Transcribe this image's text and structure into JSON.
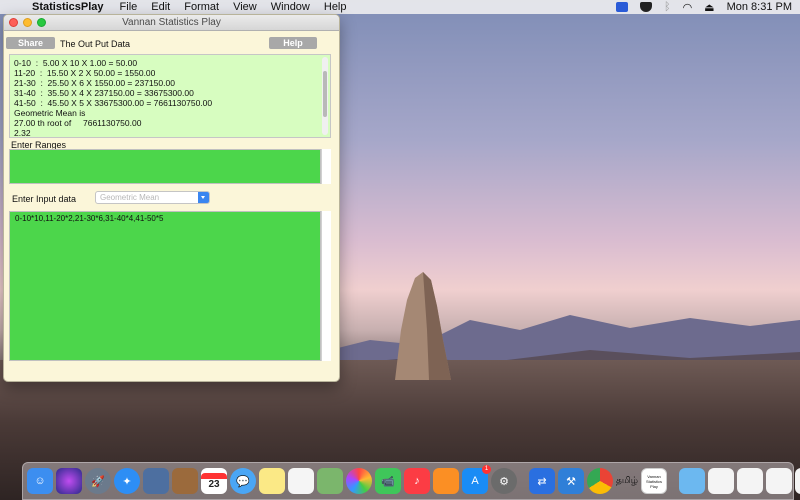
{
  "menubar": {
    "app_name": "StatisticsPlay",
    "items": [
      "File",
      "Edit",
      "Format",
      "View",
      "Window",
      "Help"
    ],
    "clock": "Mon 8:31 PM"
  },
  "window": {
    "title": "Vannan Statistics Play",
    "share_label": "Share",
    "help_label": "Help",
    "output_heading": "The Out Put Data",
    "output_lines": [
      "0-10  :  5.00 X 10 X 1.00 = 50.00",
      "11-20  :  15.50 X 2 X 50.00 = 1550.00",
      "21-30  :  25.50 X 6 X 1550.00 = 237150.00",
      "31-40  :  35.50 X 4 X 237150.00 = 33675300.00",
      "41-50  :  45.50 X 5 X 33675300.00 = 7661130750.00",
      "Geometric Mean is",
      "27.00 th root of     7661130750.00",
      "2.32"
    ],
    "ranges_label": "Enter Ranges",
    "input_label": "Enter Input data",
    "select_value": "Geometric Mean",
    "input_value": "0-10*10,11-20*2,21-30*6,31-40*4,41-50*5"
  },
  "dock": {
    "calendar_day": "23",
    "tamil_label": "தமிழ்",
    "vss_label": "Vannan Statistics Play",
    "appstore_badge": "1"
  }
}
